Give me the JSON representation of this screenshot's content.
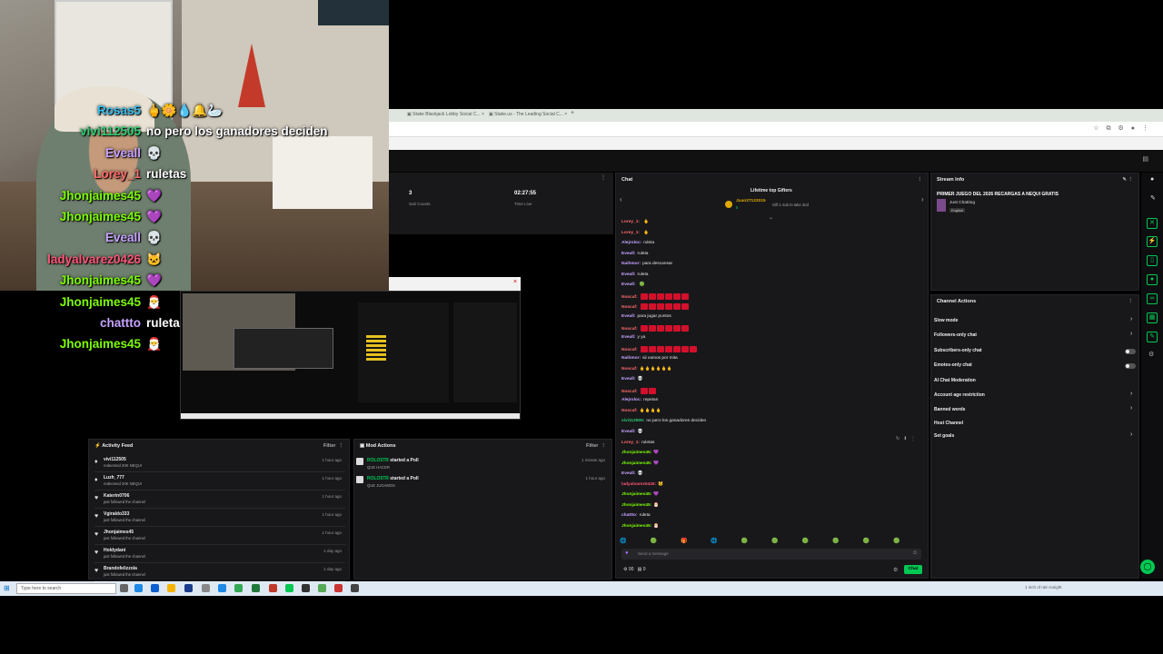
{
  "overlay_chat": [
    {
      "name": "Rosas5",
      "color": "#33bbee",
      "msg": "🖕🌼💧🔔🦢"
    },
    {
      "name": "vivi112505",
      "color": "#2ecc71",
      "msg": "no pero los ganadores deciden"
    },
    {
      "name": "Eveall",
      "color": "#c7a3ff",
      "msg": "💀"
    },
    {
      "name": "Lorey_1",
      "color": "#ff6b6b",
      "msg": "ruletas"
    },
    {
      "name": "Jhonjaimes45",
      "color": "#7cfc00",
      "msg": "💜"
    },
    {
      "name": "Jhonjaimes45",
      "color": "#7cfc00",
      "msg": "💜"
    },
    {
      "name": "Eveall",
      "color": "#c7a3ff",
      "msg": "💀"
    },
    {
      "name": "ladyalvarez0426",
      "color": "#ff5577",
      "msg": "🐱"
    },
    {
      "name": "Jhonjaimes45",
      "color": "#7cfc00",
      "msg": "💜"
    },
    {
      "name": "Jhonjaimes45",
      "color": "#7cfc00",
      "msg": "🎅"
    },
    {
      "name": "chattto",
      "color": "#c7a3ff",
      "msg": "ruleta"
    },
    {
      "name": "Jhonjaimes45",
      "color": "#7cfc00",
      "msg": "🎅"
    }
  ],
  "browser": {
    "tab1": "Stake Blackjack Lobby Social C...",
    "tab2": "Stake.us - The Leading Social C..."
  },
  "stats": {
    "sub_count": "3",
    "sub_label": "Sub Counts",
    "time": "02:27:55",
    "time_label": "Time Live"
  },
  "chat": {
    "title": "Chat",
    "gifters_title": "Lifetime top Gifters",
    "gifter_name": "Juan27122015",
    "gifter_count": "5",
    "gifter_note": "Gift 1 sub to take 2nd",
    "input_placeholder": "Send a message",
    "send_label": "Chat",
    "count_a": "00",
    "count_b": "0",
    "messages": [
      {
        "user": "Lorey_1:",
        "color": "#ff6b6b",
        "text": "",
        "emote": "🖕"
      },
      {
        "user": "Lorey_1:",
        "color": "#ff6b6b",
        "text": "",
        "emote": "🖕"
      },
      {
        "user": "Alejroloc:",
        "color": "#c7a3ff",
        "text": "ruleta",
        "emote": ""
      },
      {
        "user": "Eveall:",
        "color": "#c7a3ff",
        "text": "ruleta",
        "emote": ""
      },
      {
        "user": "Naihmor:",
        "color": "#c7a3ff",
        "text": "para descansar",
        "emote": ""
      },
      {
        "user": "Eveall:",
        "color": "#c7a3ff",
        "text": "ruleta",
        "emote": ""
      },
      {
        "user": "Eveall:",
        "color": "#c7a3ff",
        "text": "",
        "emote": "🟢"
      },
      {
        "user": "Noscaf:",
        "color": "#ff6b6b",
        "text": "",
        "emote": "reds6"
      },
      {
        "user": "Noscaf:",
        "color": "#ff6b6b",
        "text": "",
        "emote": "reds6"
      },
      {
        "user": "Eveall:",
        "color": "#c7a3ff",
        "text": "para jugar puntos",
        "emote": ""
      },
      {
        "user": "Noscaf:",
        "color": "#ff6b6b",
        "text": "",
        "emote": "reds6"
      },
      {
        "user": "Eveall:",
        "color": "#c7a3ff",
        "text": "y ya",
        "emote": ""
      },
      {
        "user": "Noscaf:",
        "color": "#ff6b6b",
        "text": "",
        "emote": "reds7"
      },
      {
        "user": "Naihmor:",
        "color": "#c7a3ff",
        "text": "sii vamos por mita",
        "emote": ""
      },
      {
        "user": "Noscaf:",
        "color": "#ff6b6b",
        "text": "🖕🖕🖕🖕🖕🖕",
        "emote": ""
      },
      {
        "user": "Eveall:",
        "color": "#c7a3ff",
        "text": "💀",
        "emote": ""
      },
      {
        "user": "Noscaf:",
        "color": "#ff6b6b",
        "text": "",
        "emote": "reds2"
      },
      {
        "user": "Alejroloc:",
        "color": "#c7a3ff",
        "text": "repetan",
        "emote": ""
      },
      {
        "user": "Noscaf:",
        "color": "#ff6b6b",
        "text": "🖕🖕🖕🖕",
        "emote": ""
      },
      {
        "user": "vivi112505:",
        "color": "#2ecc71",
        "text": "no pero los ganadores deciden",
        "emote": ""
      },
      {
        "user": "Eveall:",
        "color": "#c7a3ff",
        "text": "💀",
        "emote": ""
      },
      {
        "user": "Lorey_1:",
        "color": "#ff6b6b",
        "text": "ruletas",
        "emote": ""
      },
      {
        "user": "Jhonjaimes45:",
        "color": "#7cfc00",
        "text": "💜",
        "emote": ""
      },
      {
        "user": "Jhonjaimes45:",
        "color": "#7cfc00",
        "text": "💜",
        "emote": ""
      },
      {
        "user": "Eveall:",
        "color": "#c7a3ff",
        "text": "💀",
        "emote": ""
      },
      {
        "user": "ladyalvarez0426:",
        "color": "#ff5577",
        "text": "🐱",
        "emote": ""
      },
      {
        "user": "Jhonjaimes45:",
        "color": "#7cfc00",
        "text": "💜",
        "emote": ""
      },
      {
        "user": "Jhonjaimes45:",
        "color": "#7cfc00",
        "text": "🎅",
        "emote": ""
      },
      {
        "user": "chattto:",
        "color": "#c7a3ff",
        "text": "ruleta",
        "emote": ""
      },
      {
        "user": "Jhonjaimes45:",
        "color": "#7cfc00",
        "text": "🎅",
        "emote": ""
      }
    ]
  },
  "stream_info": {
    "title": "Stream Info",
    "stream_title": "PRIMER JUEGO DEL 2026 RECARGAS A NEQUI GRATIS",
    "category": "Just Chatting",
    "language": "English"
  },
  "channel_actions": {
    "title": "Channel Actions",
    "items": [
      "Slow mode",
      "Followers-only chat",
      "Subscribers-only chat",
      "Emotes-only chat",
      "AI Chat Moderation",
      "Account age restriction",
      "Banned words",
      "Host Channel",
      "Set goals"
    ]
  },
  "activity_feed": {
    "title": "Activity Feed",
    "filter": "Filter",
    "items": [
      {
        "user": "vivi112505",
        "action": "redeemed 20K NEQUI",
        "time": "1 hour ago",
        "icon": "gift"
      },
      {
        "user": "Luzh_777",
        "action": "redeemed 20K NEQUI",
        "time": "1 hour ago",
        "icon": "gift"
      },
      {
        "user": "Katerin0706",
        "action": "just followed the channel",
        "time": "1 hour ago",
        "icon": "heart"
      },
      {
        "user": "Vgiraldo333",
        "action": "just followed the channel",
        "time": "1 hour ago",
        "icon": "heart"
      },
      {
        "user": "Jhonjaimes45",
        "action": "just followed the channel",
        "time": "1 hour ago",
        "icon": "heart"
      },
      {
        "user": "Holdydani",
        "action": "just followed the channel",
        "time": "1 day ago",
        "icon": "heart"
      },
      {
        "user": "Brandofelizzola",
        "action": "just followed the channel",
        "time": "1 day ago",
        "icon": "heart"
      }
    ]
  },
  "mod_actions": {
    "title": "Mod Actions",
    "filter": "Filter",
    "items": [
      {
        "user": "ROLO5TR",
        "action": "started a Poll",
        "sub": "QUE HACER",
        "time": "1 minute ago"
      },
      {
        "user": "ROLO5TR",
        "action": "started a Poll",
        "sub": "QUE JUGAMOS",
        "time": "1 hour ago"
      }
    ]
  },
  "taskbar": {
    "search": "Type here to search",
    "weather": "1 inch of rain tonight"
  }
}
